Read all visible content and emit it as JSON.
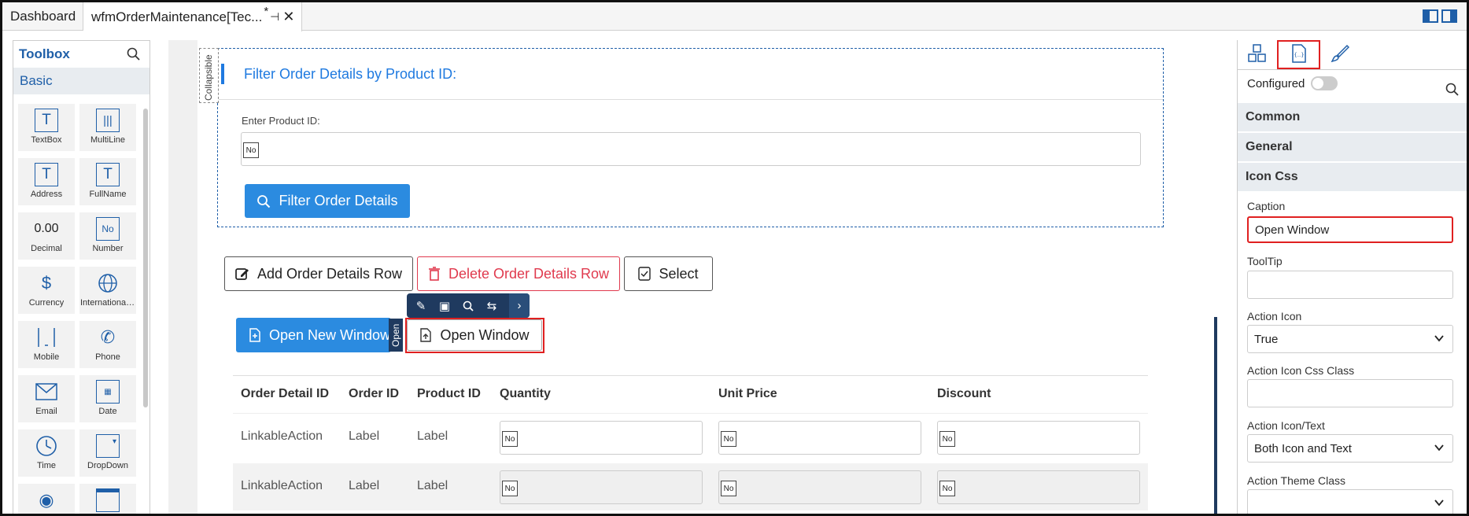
{
  "tabs": {
    "dashboard": "Dashboard",
    "active": "wfmOrderMaintenance[Tec...",
    "modified": "*"
  },
  "toolbox": {
    "title": "Toolbox",
    "category": "Basic",
    "items": [
      {
        "label": "TextBox",
        "icon": "T"
      },
      {
        "label": "MultiLine",
        "icon": "|||"
      },
      {
        "label": "Address",
        "icon": "T"
      },
      {
        "label": "FullName",
        "icon": "T"
      },
      {
        "label": "Decimal",
        "icon": "0.00"
      },
      {
        "label": "Number",
        "icon": "No"
      },
      {
        "label": "Currency",
        "icon": "$"
      },
      {
        "label": "International ...",
        "icon": "globe"
      },
      {
        "label": "Mobile",
        "icon": "mobile"
      },
      {
        "label": "Phone",
        "icon": "phone"
      },
      {
        "label": "Email",
        "icon": "envelope"
      },
      {
        "label": "Date",
        "icon": "calendar"
      },
      {
        "label": "Time",
        "icon": "clock"
      },
      {
        "label": "DropDown",
        "icon": "dropdown"
      },
      {
        "label": "",
        "icon": "radio"
      },
      {
        "label": "",
        "icon": "window"
      }
    ]
  },
  "form": {
    "collapsible_tag": "Collapsible",
    "section_title": "Filter Order Details by Product ID:",
    "product_label": "Enter Product ID:",
    "no_icon": "No",
    "filter_button": "Filter Order Details",
    "add_button": "Add Order Details Row",
    "delete_button": "Delete Order Details Row",
    "select_button": "Select",
    "open_new_button": "Open New Window",
    "open_tag": "Open",
    "open_window_button": "Open Window"
  },
  "grid": {
    "columns": [
      "Order Detail ID",
      "Order ID",
      "Product ID",
      "Quantity",
      "Unit Price",
      "Discount"
    ],
    "rows": [
      [
        "LinkableAction",
        "Label",
        "Label"
      ],
      [
        "LinkableAction",
        "Label",
        "Label"
      ]
    ]
  },
  "panel": {
    "configured_label": "Configured",
    "sections": [
      "Common",
      "General",
      "Icon Css"
    ],
    "caption_label": "Caption",
    "caption_value": "Open Window",
    "tooltip_label": "ToolTip",
    "tooltip_value": "",
    "action_icon_label": "Action Icon",
    "action_icon_value": "True",
    "action_icon_css_label": "Action Icon Css Class",
    "action_icon_css_value": "",
    "action_icon_text_label": "Action Icon/Text",
    "action_icon_text_value": "Both Icon and Text",
    "action_theme_label": "Action Theme Class",
    "action_theme_value": ""
  },
  "colors": {
    "accent": "#2b8be0",
    "danger": "#e03a4e",
    "highlight": "#e02020",
    "toolbar": "#1f3a5f"
  }
}
